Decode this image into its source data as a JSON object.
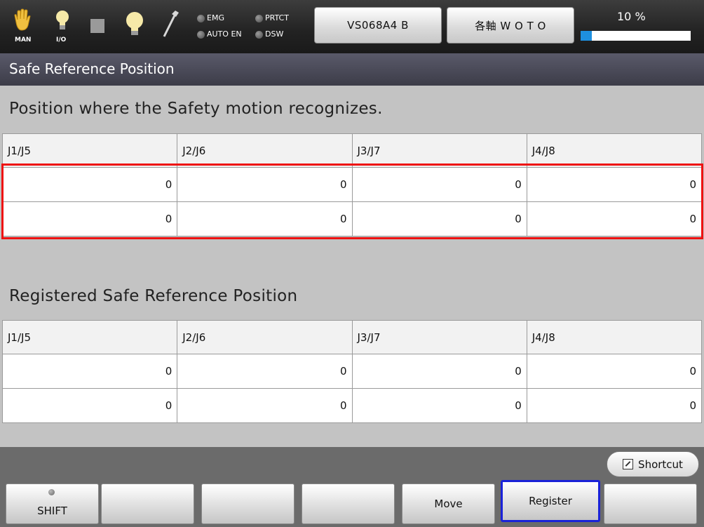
{
  "topbar": {
    "mode_label": "MAN",
    "io_label": "I/O",
    "indicators": [
      "EMG",
      "PRTCT",
      "AUTO EN",
      "DSW"
    ],
    "robot_button": "VS068A4 B",
    "jog_button": "各軸 W O T O",
    "speed_text": "10 %",
    "speed_percent": 10,
    "speed_color": "#1e90e0"
  },
  "title": "Safe Reference Position",
  "section1": {
    "heading": "Position where the Safety motion recognizes.",
    "headers": [
      "J1/J5",
      "J2/J6",
      "J3/J7",
      "J4/J8"
    ],
    "rows": [
      [
        "0",
        "0",
        "0",
        "0"
      ],
      [
        "0",
        "0",
        "0",
        "0"
      ]
    ],
    "highlight_color": "#ee1111"
  },
  "section2": {
    "heading": "Registered Safe Reference Position",
    "headers": [
      "J1/J5",
      "J2/J6",
      "J3/J7",
      "J4/J8"
    ],
    "rows": [
      [
        "0",
        "0",
        "0",
        "0"
      ],
      [
        "0",
        "0",
        "0",
        "0"
      ]
    ]
  },
  "shortcut_label": "Shortcut",
  "function_keys": [
    "SHIFT",
    "",
    "",
    "",
    "Move",
    "Register",
    ""
  ],
  "active_key_color": "#1a22d8"
}
